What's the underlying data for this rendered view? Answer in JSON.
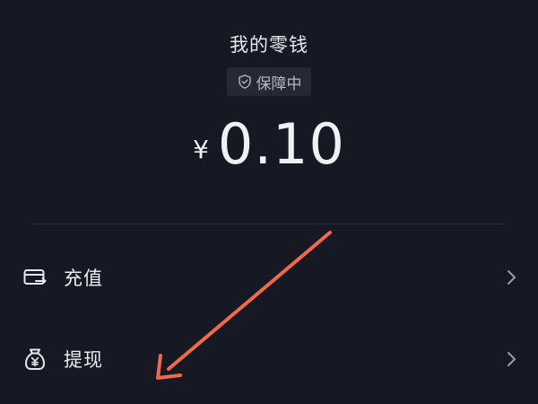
{
  "wallet": {
    "title": "我的零钱",
    "badge": "保障中",
    "currency_symbol": "¥",
    "balance": "0.10"
  },
  "menu": {
    "items": [
      {
        "label": "充值",
        "icon": "recharge-card-icon"
      },
      {
        "label": "提现",
        "icon": "money-bag-icon"
      }
    ]
  },
  "annotation": {
    "arrow_color": "#f06a4a"
  }
}
